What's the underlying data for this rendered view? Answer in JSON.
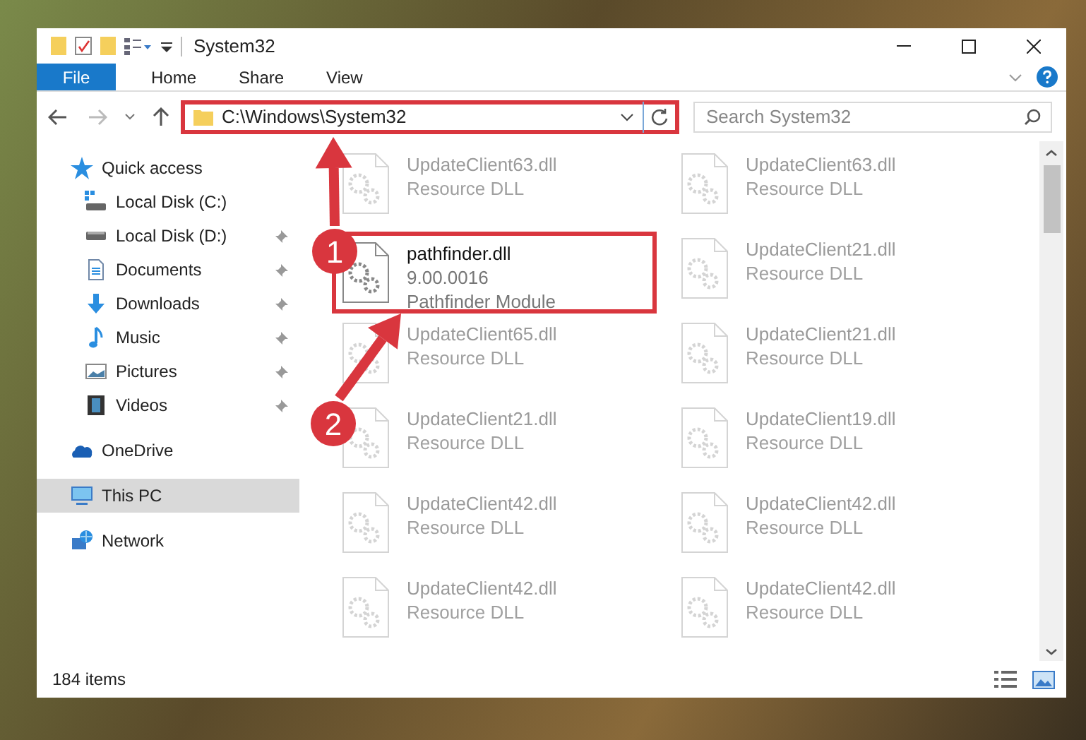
{
  "window": {
    "title": "System32"
  },
  "ribbon": {
    "tabs": [
      {
        "label": "File",
        "kind": "file"
      },
      {
        "label": "Home",
        "kind": "tab"
      },
      {
        "label": "Share",
        "kind": "tab"
      },
      {
        "label": "View",
        "kind": "tab"
      }
    ]
  },
  "address": {
    "path": "C:\\Windows\\System32",
    "highlighted": true
  },
  "search": {
    "placeholder": "Search System32"
  },
  "sidebar": {
    "items": [
      {
        "label": "Quick access",
        "kind": "star",
        "selected": false,
        "children": [
          {
            "label": "Local Disk (C:)",
            "kind": "drive-c",
            "selected": false,
            "pinned": false
          },
          {
            "label": "Local Disk (D:)",
            "kind": "drive",
            "selected": false,
            "pinned": true
          },
          {
            "label": "Documents",
            "kind": "documents",
            "selected": false,
            "pinned": true
          },
          {
            "label": "Downloads",
            "kind": "downloads",
            "selected": false,
            "pinned": true
          },
          {
            "label": "Music",
            "kind": "music",
            "selected": false,
            "pinned": true
          },
          {
            "label": "Pictures",
            "kind": "pictures",
            "selected": false,
            "pinned": true
          },
          {
            "label": "Videos",
            "kind": "videos",
            "selected": false,
            "pinned": true
          }
        ]
      },
      {
        "label": "OneDrive",
        "kind": "cloud",
        "selected": false
      },
      {
        "label": "This PC",
        "kind": "pc",
        "selected": true
      },
      {
        "label": "Network",
        "kind": "network",
        "selected": false
      }
    ]
  },
  "files": [
    {
      "name": "UpdateClient63.dll",
      "details": [
        "Resource DLL"
      ],
      "dimmed": true,
      "highlighted": false
    },
    {
      "name": "UpdateClient63.dll",
      "details": [
        "Resource DLL"
      ],
      "dimmed": true,
      "highlighted": false
    },
    {
      "name": "pathfinder.dll",
      "details": [
        "9.00.0016",
        "Pathfinder Module"
      ],
      "dimmed": false,
      "highlighted": true
    },
    {
      "name": "UpdateClient21.dll",
      "details": [
        "Resource DLL"
      ],
      "dimmed": true,
      "highlighted": false
    },
    {
      "name": "UpdateClient65.dll",
      "details": [
        "Resource DLL"
      ],
      "dimmed": true,
      "highlighted": false
    },
    {
      "name": "UpdateClient21.dll",
      "details": [
        "Resource DLL"
      ],
      "dimmed": true,
      "highlighted": false
    },
    {
      "name": "UpdateClient21.dll",
      "details": [
        "Resource DLL"
      ],
      "dimmed": true,
      "highlighted": false
    },
    {
      "name": "UpdateClient19.dll",
      "details": [
        "Resource DLL"
      ],
      "dimmed": true,
      "highlighted": false
    },
    {
      "name": "UpdateClient42.dll",
      "details": [
        "Resource DLL"
      ],
      "dimmed": true,
      "highlighted": false
    },
    {
      "name": "UpdateClient42.dll",
      "details": [
        "Resource DLL"
      ],
      "dimmed": true,
      "highlighted": false
    },
    {
      "name": "UpdateClient42.dll",
      "details": [
        "Resource DLL"
      ],
      "dimmed": true,
      "highlighted": false
    },
    {
      "name": "UpdateClient42.dll",
      "details": [
        "Resource DLL"
      ],
      "dimmed": true,
      "highlighted": false
    }
  ],
  "status_bar": {
    "count": "184 items"
  },
  "annotations": [
    {
      "label": "1"
    },
    {
      "label": "2"
    }
  ]
}
